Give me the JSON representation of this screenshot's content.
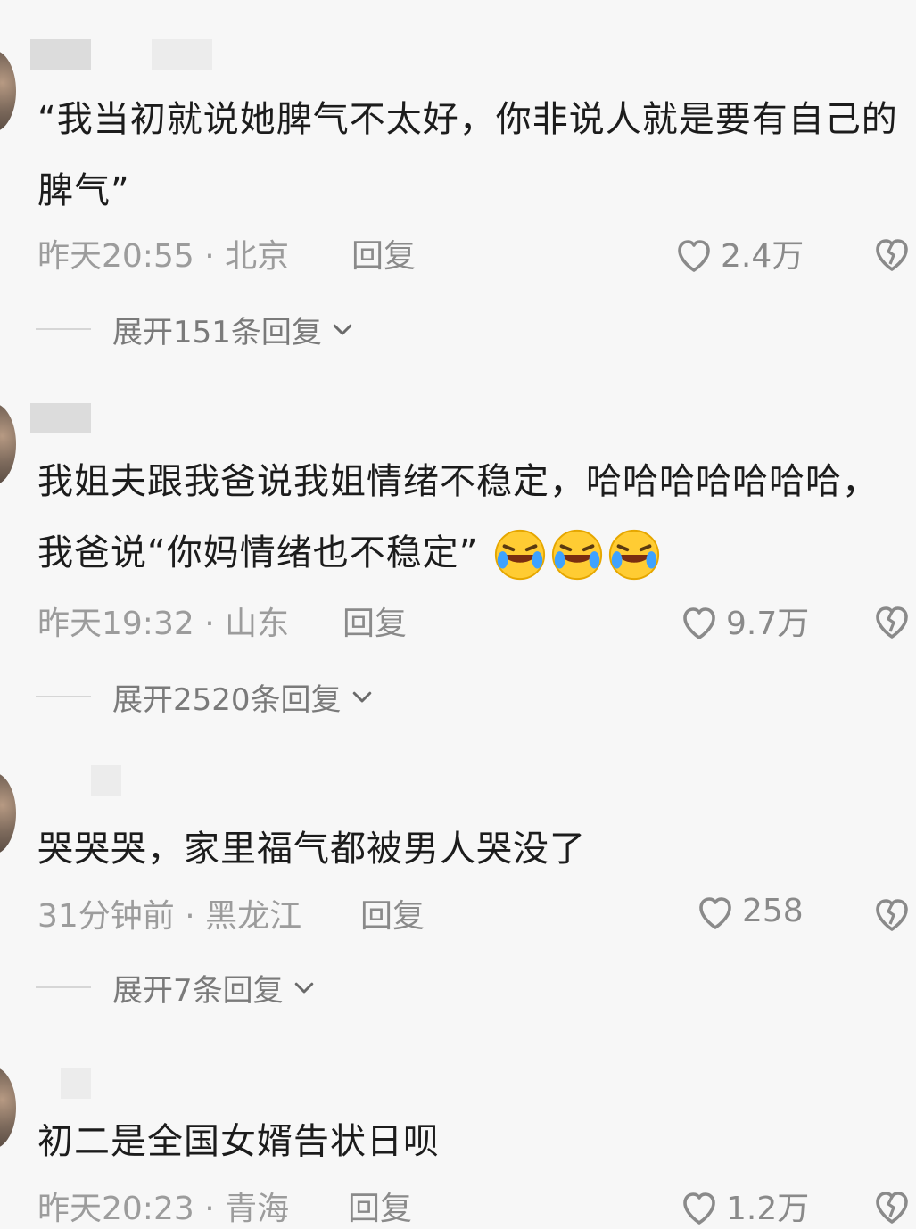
{
  "comments": [
    {
      "text": "“我当初就说她脾气不太好，你非说人就是要有自己的脾气”",
      "time_location": "昨天20:55 · 北京",
      "reply_label": "回复",
      "likes": "2.4万",
      "expand_label": "展开151条回复"
    },
    {
      "text": "我姐夫跟我爸说我姐情绪不稳定，哈哈哈哈哈哈哈，我爸说“你妈情绪也不稳定”",
      "emoji_count": 3,
      "emoji_name": "rofl-emoji",
      "time_location": "昨天19:32 · 山东",
      "reply_label": "回复",
      "likes": "9.7万",
      "expand_label": "展开2520条回复"
    },
    {
      "text": "哭哭哭，家里福气都被男人哭没了",
      "time_location": "31分钟前 · 黑龙江",
      "reply_label": "回复",
      "likes": "258",
      "expand_label": "展开7条回复"
    },
    {
      "text": "初二是全国女婿告状日呗",
      "time_location": "昨天20:23 · 青海",
      "reply_label": "回复",
      "likes": "1.2万"
    }
  ],
  "icons": {
    "like": "heart-outline-icon",
    "dislike": "broken-heart-icon",
    "expand": "chevron-down-icon"
  },
  "colors": {
    "background": "#f7f7f7",
    "text": "#1c1c1c",
    "meta": "#9c9c9c"
  }
}
